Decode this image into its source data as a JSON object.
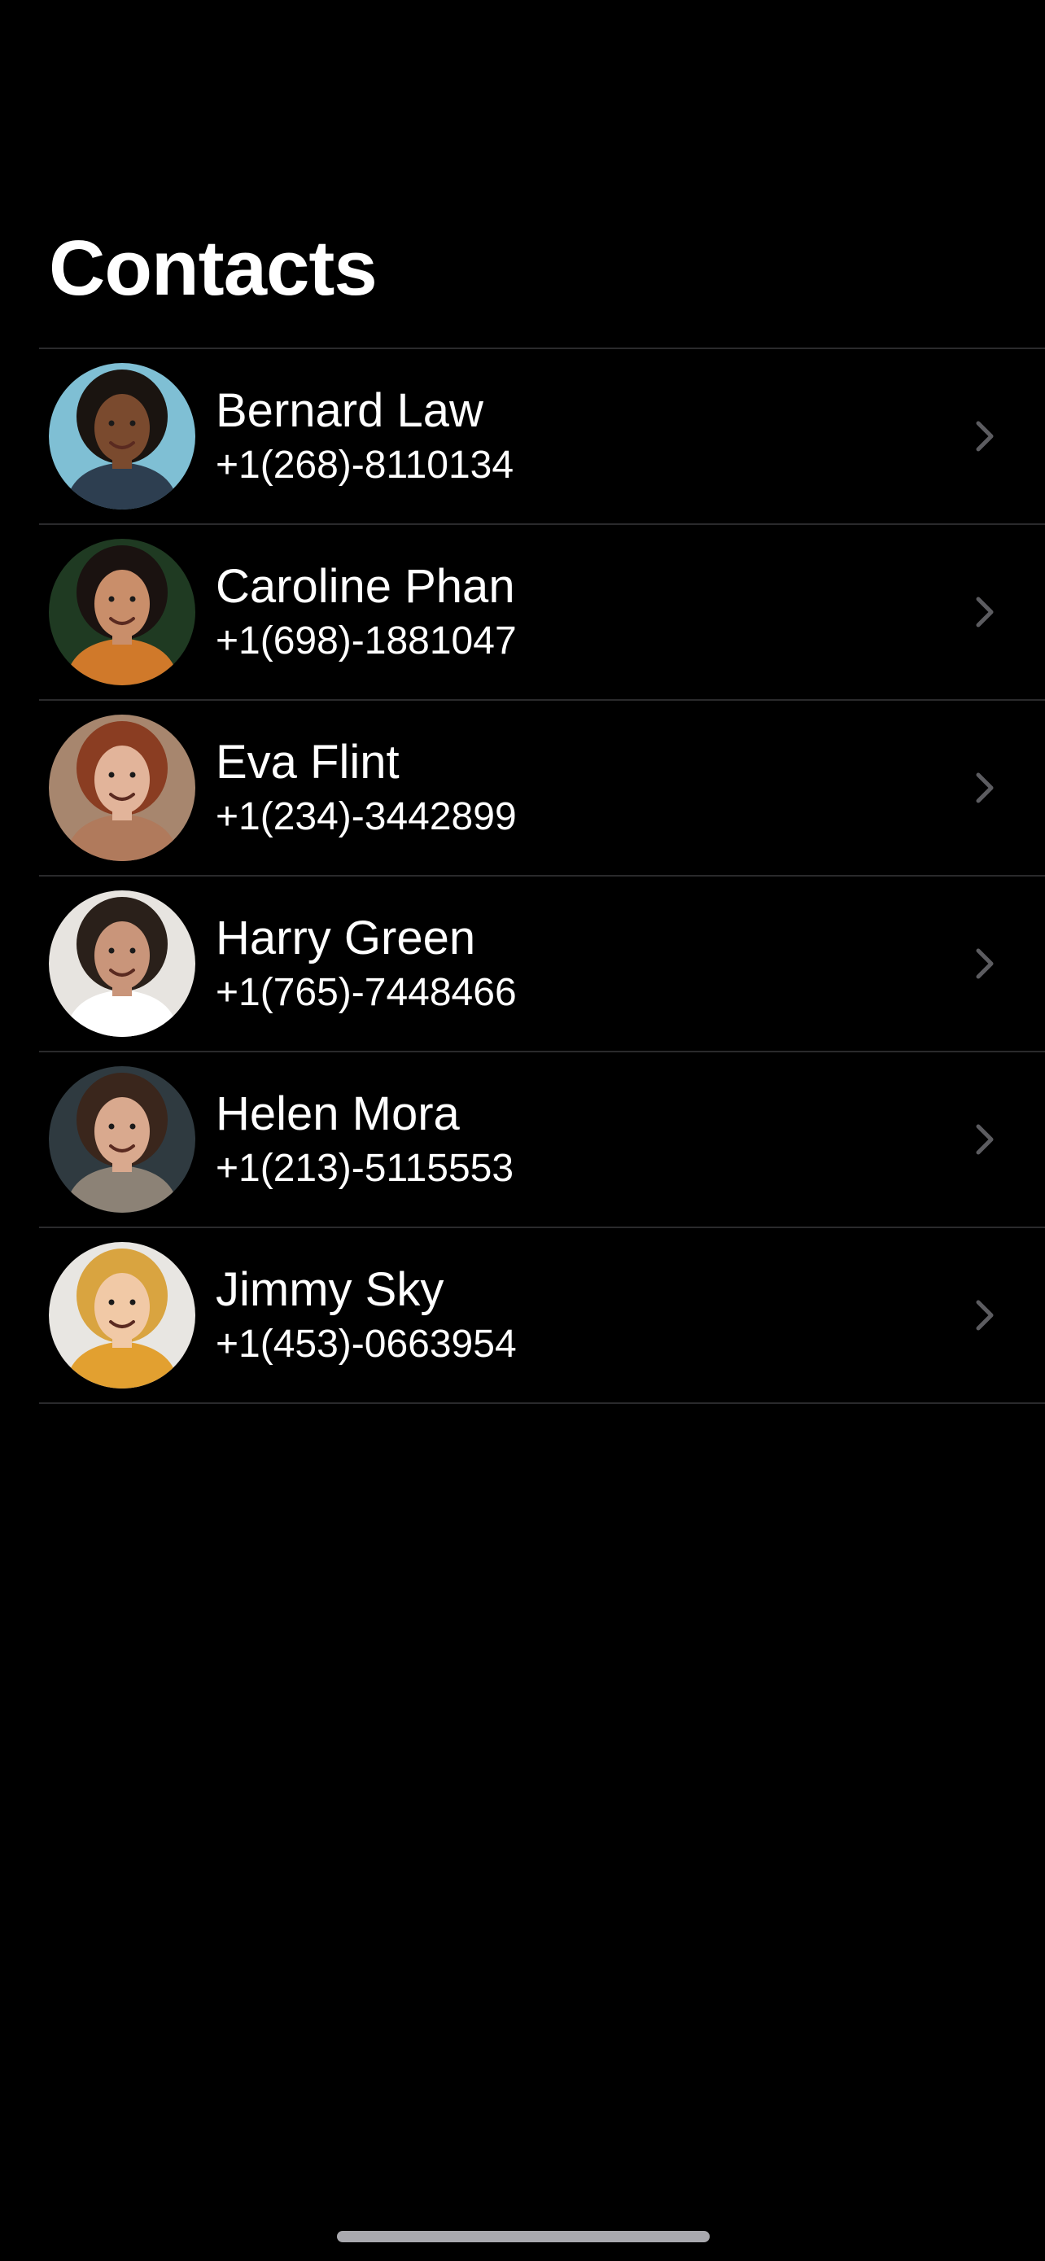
{
  "header": {
    "title": "Contacts"
  },
  "contacts": [
    {
      "name": "Bernard Law",
      "phone": "+1(268)-8110134",
      "avatar_icon": "person-photo-bernard",
      "avatar_bg": "#7fbfd4",
      "skin": "#7a4a2e",
      "hair": "#1a1410",
      "shirt": "#2d3e50"
    },
    {
      "name": "Caroline Phan",
      "phone": "+1(698)-1881047",
      "avatar_icon": "person-photo-caroline",
      "avatar_bg": "#1f3a22",
      "skin": "#c98e6a",
      "hair": "#1a1210",
      "shirt": "#d0792a"
    },
    {
      "name": "Eva Flint",
      "phone": "+1(234)-3442899",
      "avatar_icon": "person-photo-eva",
      "avatar_bg": "#a7866e",
      "skin": "#e2b49a",
      "hair": "#8a3d22",
      "shirt": "#b07a5c"
    },
    {
      "name": "Harry Green",
      "phone": "+1(765)-7448466",
      "avatar_icon": "person-photo-harry",
      "avatar_bg": "#e7e4e0",
      "skin": "#c9957a",
      "hair": "#2a201a",
      "shirt": "#ffffff"
    },
    {
      "name": "Helen Mora",
      "phone": "+1(213)-5115553",
      "avatar_icon": "person-photo-helen",
      "avatar_bg": "#2f3a40",
      "skin": "#d9a98e",
      "hair": "#3a261c",
      "shirt": "#8c8276"
    },
    {
      "name": "Jimmy Sky",
      "phone": "+1(453)-0663954",
      "avatar_icon": "person-photo-jimmy",
      "avatar_bg": "#e8e6e2",
      "skin": "#f1c9a6",
      "hair": "#d9a440",
      "shirt": "#e2a030"
    }
  ],
  "colors": {
    "background": "#000000",
    "separator": "#2a2a2c",
    "chevron": "#5c5c60",
    "text": "#ffffff"
  }
}
